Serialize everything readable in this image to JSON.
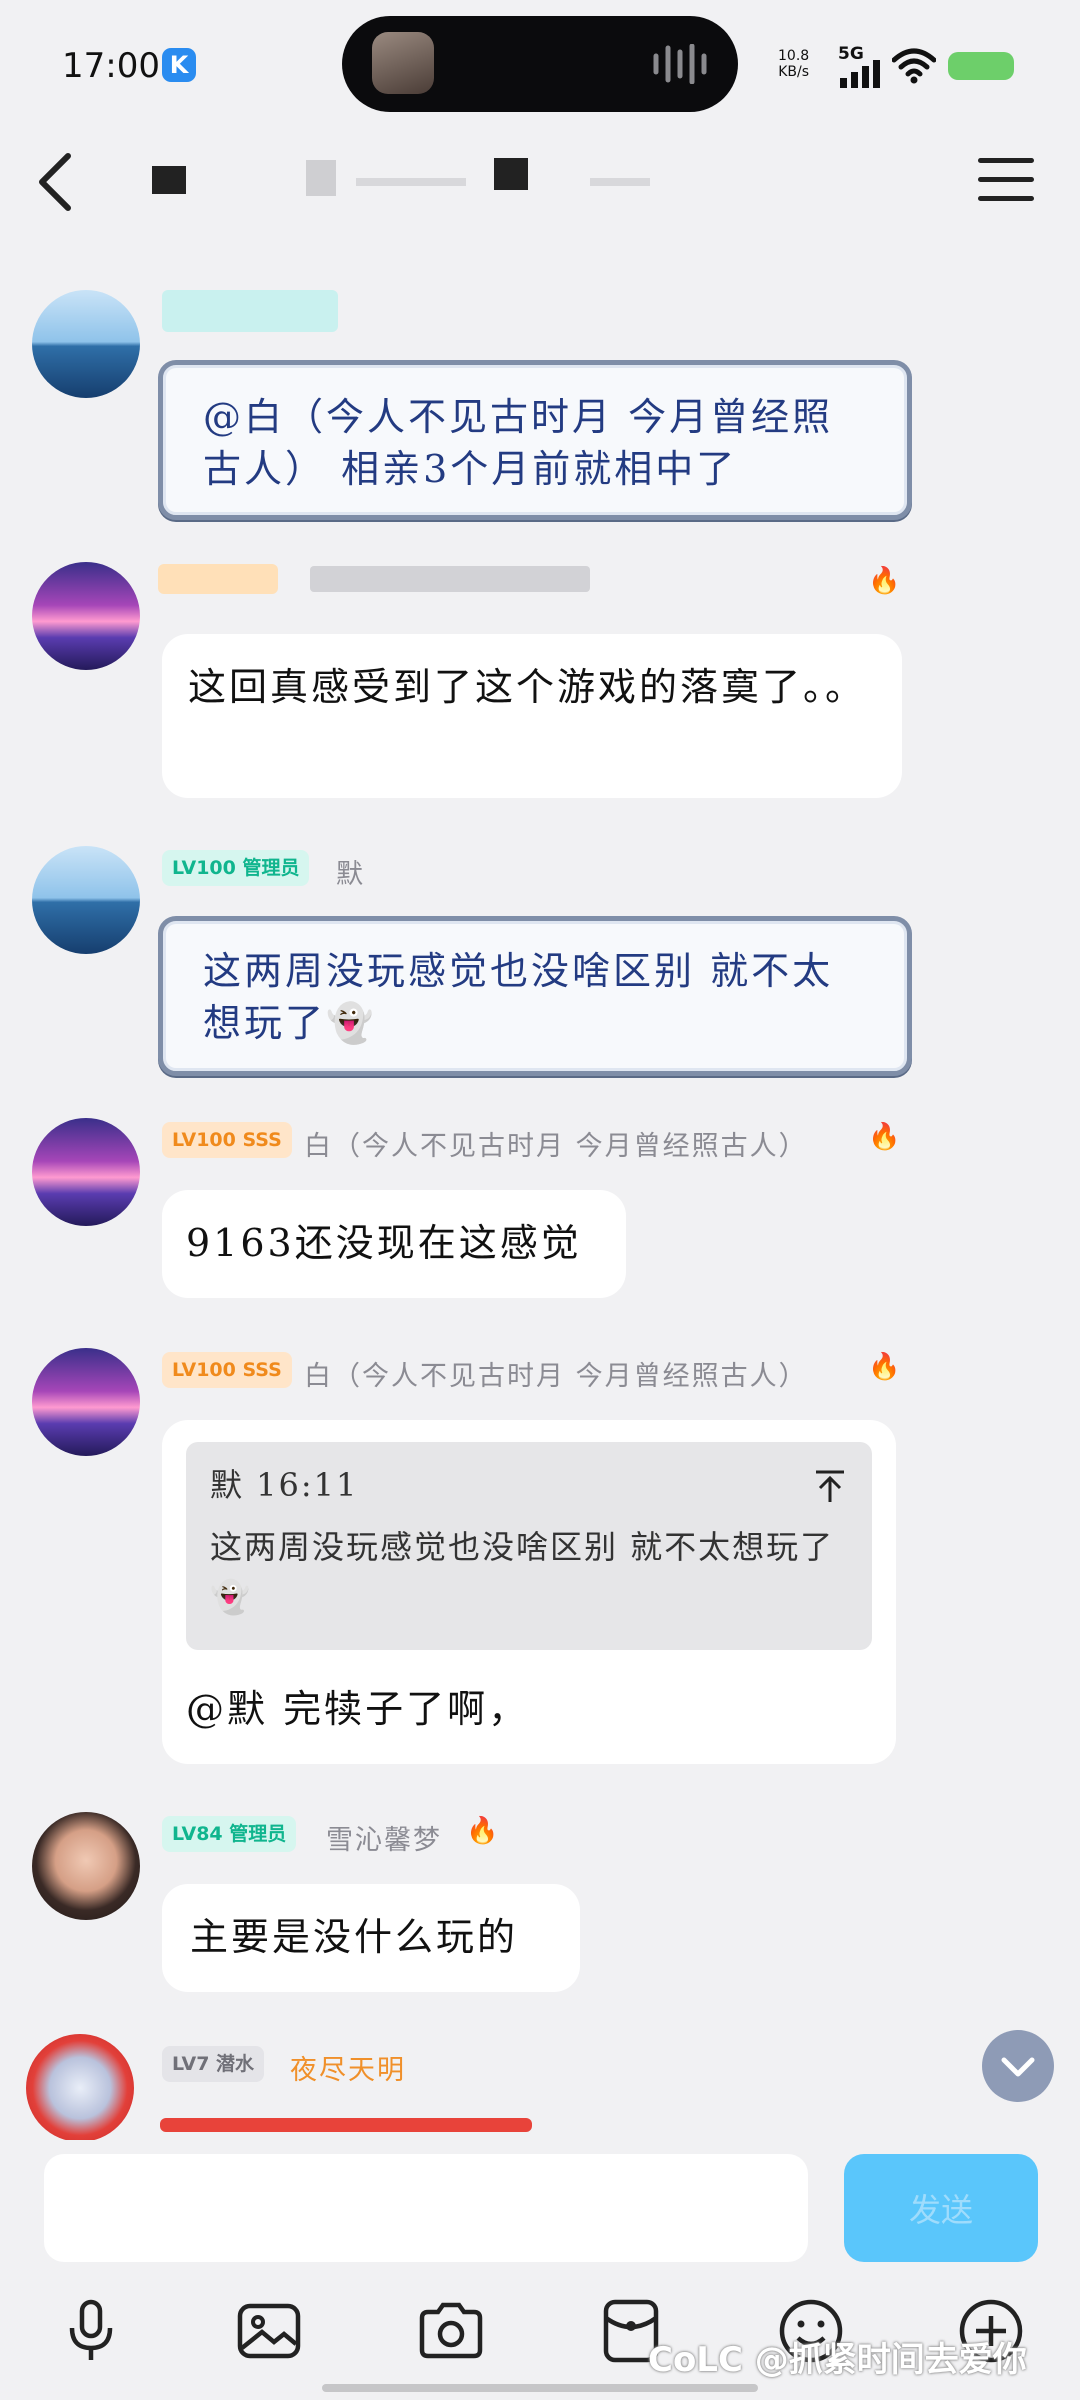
{
  "status_bar": {
    "time": "17:00",
    "app_badge": "K",
    "net_speed_value": "10.8",
    "net_speed_unit": "KB/s",
    "network": "5G"
  },
  "header": {
    "title": "",
    "back_icon": "chevron-left-icon",
    "menu_icon": "hamburger-menu-icon"
  },
  "messages": [
    {
      "badge": "",
      "sender": "",
      "style": "scroll",
      "text": "@白（今人不见古时月 今月曾经照古人） 相亲3个月前就相中了"
    },
    {
      "badge": "",
      "sender": "",
      "style": "plain",
      "text": "这回真感受到了这个游戏的落寞了。。"
    },
    {
      "badge": "LV100 管理员",
      "sender": "默",
      "style": "scroll",
      "text": "这两周没玩感觉也没啥区别 就不太想玩了👻"
    },
    {
      "badge": "LV100 SSS",
      "sender": "白（今人不见古时月 今月曾经照古人）",
      "style": "plain",
      "text": "9163还没现在这感觉"
    },
    {
      "badge": "LV100 SSS",
      "sender": "白（今人不见古时月 今月曾经照古人）",
      "style": "reply",
      "quote_author": "默 16:11",
      "quote_text": "这两周没玩感觉也没啥区别 就不太想玩了👻",
      "text": "@默 完犊子了啊，"
    },
    {
      "badge": "LV84 管理员",
      "sender": "雪沁馨梦",
      "style": "plain",
      "text": "主要是没什么玩的"
    },
    {
      "badge": "LV7 潜水",
      "sender": "夜尽天明",
      "style": "partial",
      "text": ""
    }
  ],
  "composer": {
    "input_value": "",
    "input_placeholder": "",
    "send_label": "发送"
  },
  "toolbar": [
    "microphone-icon",
    "image-icon",
    "camera-icon",
    "red-packet-icon",
    "emoji-icon",
    "plus-icon"
  ],
  "watermark": "CoLC @抓紧时间去爱你",
  "colors": {
    "background": "#f1f1f3",
    "scroll_text": "#233b82",
    "send_button": "#5ac6fb",
    "badge_teal": "#10b58e",
    "badge_orange": "#f08a1c"
  }
}
